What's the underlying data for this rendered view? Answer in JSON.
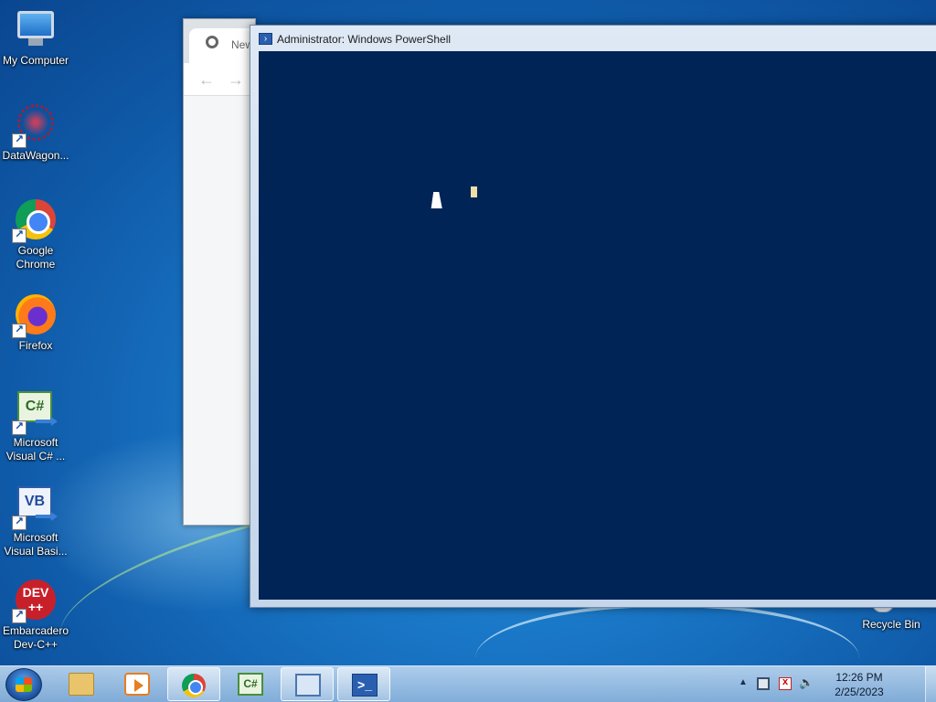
{
  "desktop": {
    "icons": [
      {
        "label": "My Computer"
      },
      {
        "label": "DataWagon..."
      },
      {
        "label": "Google Chrome"
      },
      {
        "label": "Firefox"
      },
      {
        "label": "Microsoft Visual C# ..."
      },
      {
        "label": "Microsoft Visual Basi..."
      },
      {
        "label": "Embarcadero Dev-C++"
      },
      {
        "label": "Recycle Bin"
      }
    ]
  },
  "chrome_window": {
    "tab_title": "New",
    "back_icon": "arrow-left",
    "forward_icon": "arrow-right"
  },
  "powershell_window": {
    "title": "Administrator: Windows PowerShell",
    "console_bg": "#012456",
    "cursor_color": "#eedfa6"
  },
  "dev_icon_text": "DEV\n++",
  "cs_icon_text": "C#",
  "vb_icon_text": "VB",
  "taskbar": {
    "pinned": [
      "windows-explorer",
      "media-player",
      "google-chrome",
      "visual-csharp",
      "control-panel",
      "windows-powershell"
    ],
    "ps_icon_text": ">_",
    "cs_icon_text": "C#",
    "clock": {
      "time": "12:26 PM",
      "date": "2/25/2023"
    }
  }
}
